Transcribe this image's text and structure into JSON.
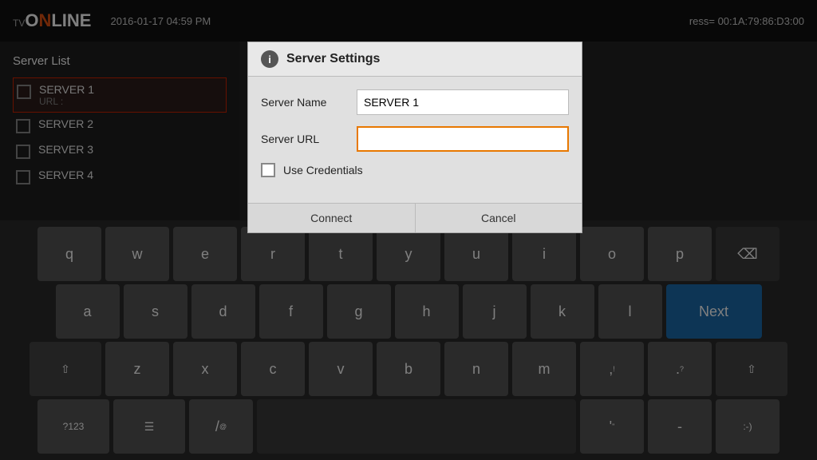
{
  "topbar": {
    "logo_tv": "TV",
    "logo_online_main": "ONLINE",
    "datetime": "2016-01-17 04:59 PM",
    "mac_label": "ress= 00:1A:79:86:D3:00"
  },
  "server_list": {
    "title": "Server List",
    "servers": [
      {
        "name": "SERVER 1",
        "url": "URL :",
        "active": true
      },
      {
        "name": "SERVER 2",
        "url": "",
        "active": false
      },
      {
        "name": "SERVER 3",
        "url": "",
        "active": false
      },
      {
        "name": "SERVER 4",
        "url": "",
        "active": false
      }
    ]
  },
  "modal": {
    "title": "Server Settings",
    "info_icon": "i",
    "server_name_label": "Server Name",
    "server_name_value": "SERVER 1",
    "server_url_label": "Server URL",
    "server_url_value": "",
    "credentials_label": "Use Credentials",
    "connect_btn": "Connect",
    "cancel_btn": "Cancel"
  },
  "keyboard": {
    "rows": [
      [
        "q",
        "w",
        "e",
        "r",
        "t",
        "y",
        "u",
        "i",
        "o",
        "p"
      ],
      [
        "a",
        "s",
        "d",
        "f",
        "g",
        "h",
        "j",
        "k",
        "l"
      ],
      [
        "z",
        "x",
        "c",
        "v",
        "b",
        "n",
        "m",
        ",",
        "."
      ],
      [
        "?123",
        "☰",
        "/",
        "",
        "'",
        "-",
        ":-)"
      ]
    ],
    "next_label": "Next",
    "backspace_icon": "⌫",
    "shift_icon": "⇧",
    "space_value": ""
  }
}
